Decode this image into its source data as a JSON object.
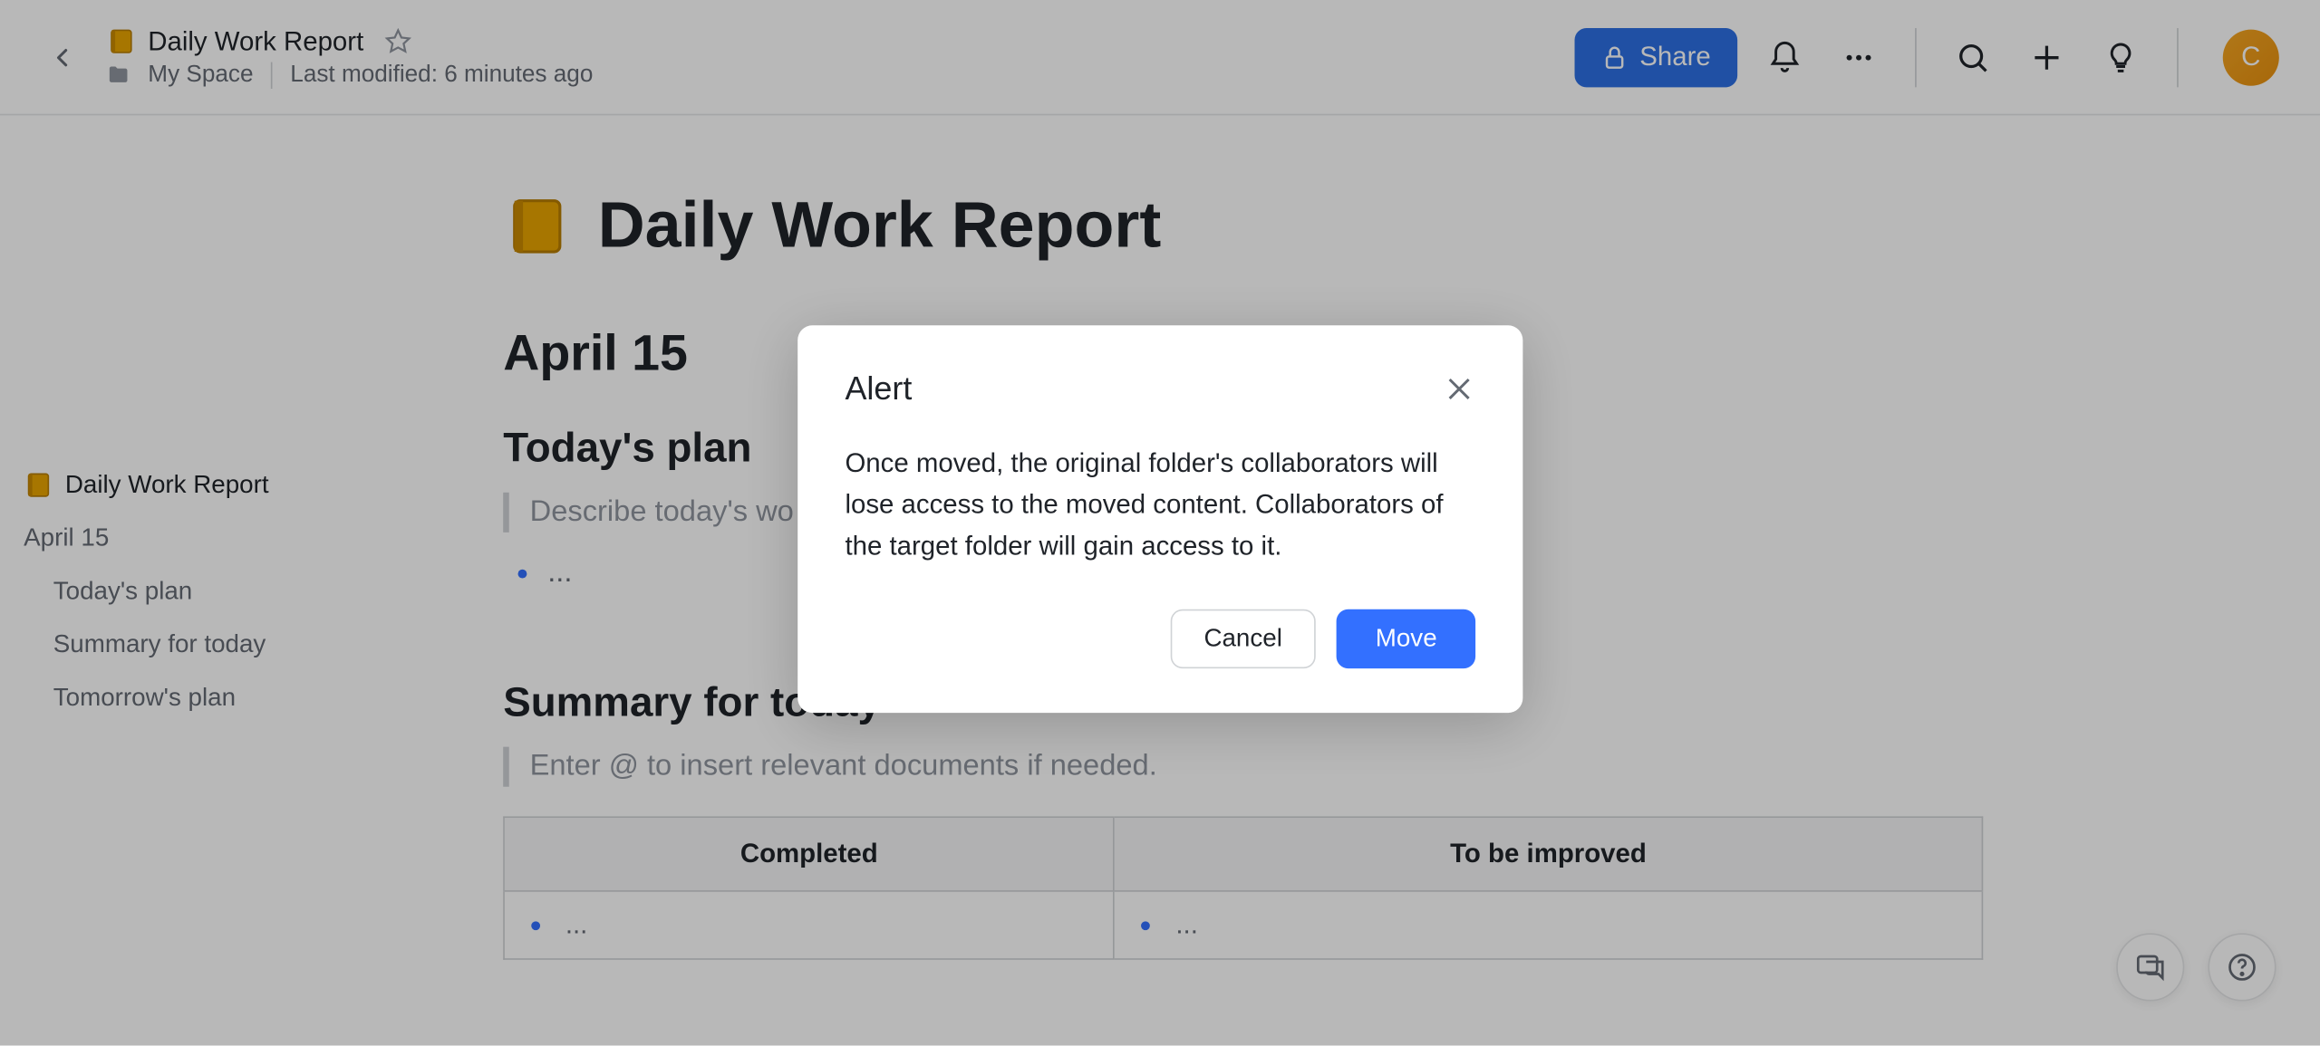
{
  "header": {
    "page_name": "Daily Work Report",
    "breadcrumb": "My Space",
    "last_modified": "Last modified: 6 minutes ago",
    "share_label": "Share",
    "avatar_initial": "C"
  },
  "outline": {
    "title": "Daily Work Report",
    "items": [
      "April 15",
      "Today's plan",
      "Summary for today",
      "Tomorrow's plan"
    ]
  },
  "content": {
    "doc_title": "Daily Work Report",
    "date_heading": "April 15",
    "todays_plan": {
      "heading": "Today's plan",
      "placeholder": "Describe today's wo",
      "bullet": "..."
    },
    "summary": {
      "heading": "Summary for today",
      "placeholder": "Enter @ to insert relevant documents if needed.",
      "table": {
        "col1": "Completed",
        "col2": "To be improved",
        "cell_placeholder": "..."
      }
    }
  },
  "modal": {
    "title": "Alert",
    "body": "Once moved, the original folder's collaborators will lose access to the moved content. Collaborators of the target folder will gain access to it.",
    "cancel": "Cancel",
    "confirm": "Move"
  }
}
